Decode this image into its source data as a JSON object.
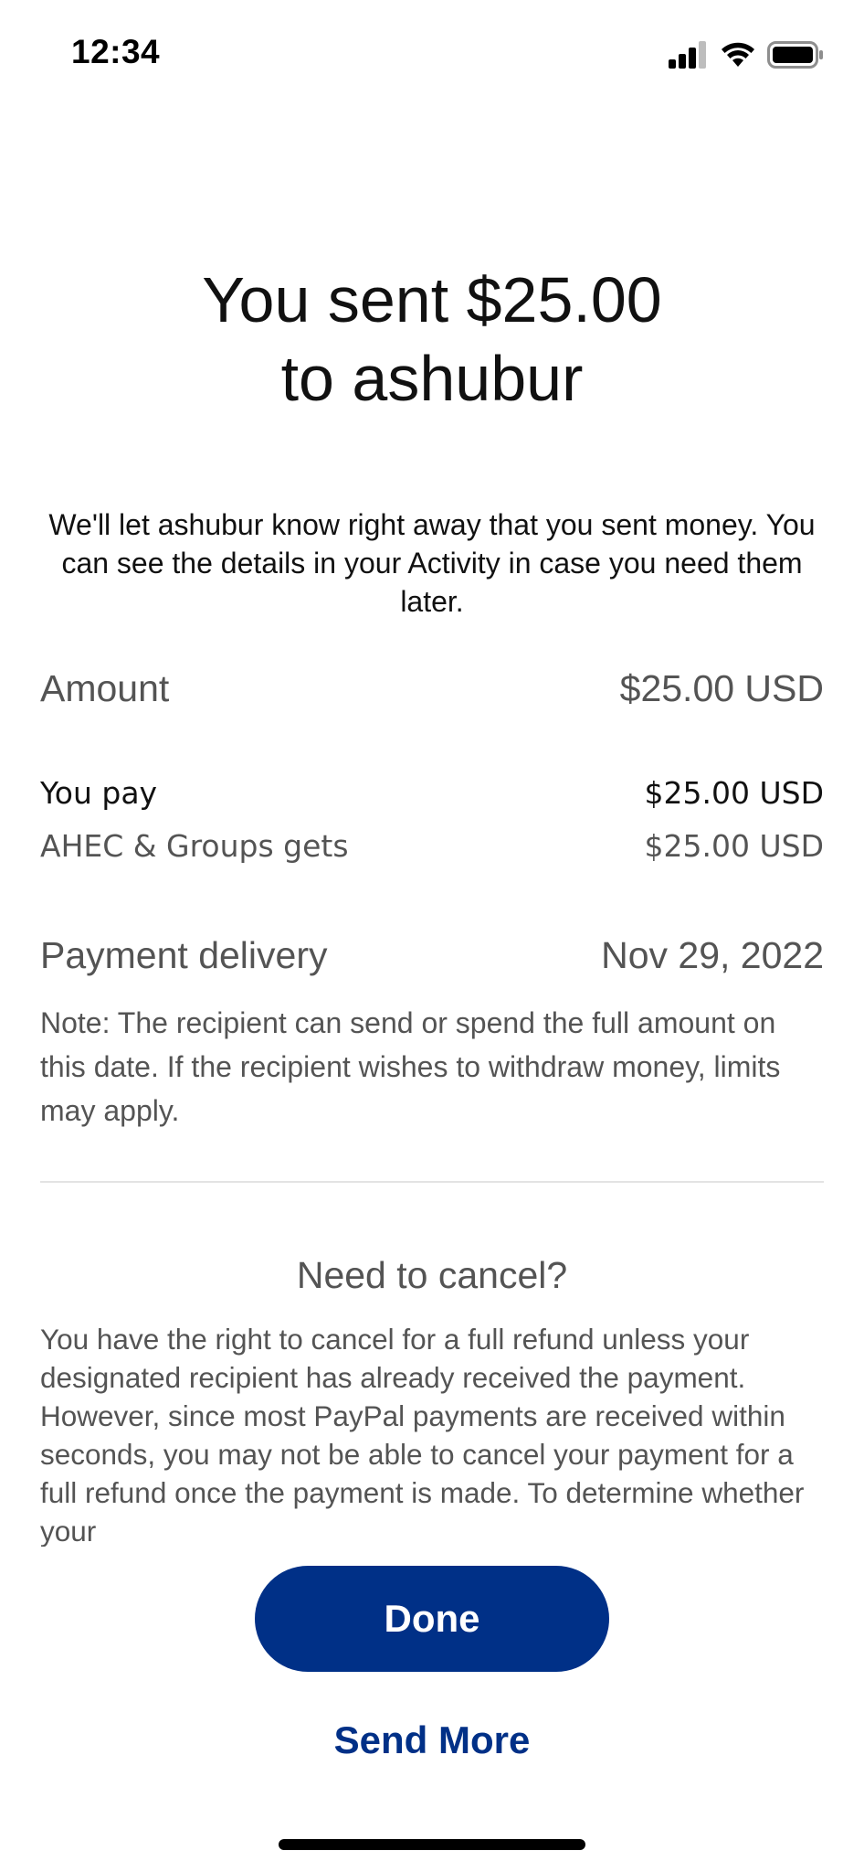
{
  "status_bar": {
    "time": "12:34",
    "icons": [
      "signal-icon",
      "wifi-icon",
      "battery-icon"
    ]
  },
  "header": {
    "title_line1": "You sent $25.00",
    "title_line2": "to ashubur",
    "subtitle": "We'll let ashubur know right away that you sent money. You can see the details in your Activity in case you need them later."
  },
  "details": {
    "amount_label": "Amount",
    "amount_value": "$25.00 USD",
    "you_pay_label": "You pay",
    "you_pay_value": "$25.00 USD",
    "recipient_gets_label": "AHEC & Groups gets",
    "recipient_gets_value": "$25.00 USD",
    "delivery_label": "Payment delivery",
    "delivery_value": "Nov 29, 2022",
    "note": "Note: The recipient can send or spend the full amount on this date. If the recipient wishes to withdraw money, limits may apply."
  },
  "cancel": {
    "heading": "Need to cancel?",
    "body": "You have the right to cancel for a full refund unless your designated recipient has already received the payment. However, since most PayPal payments are received within seconds, you may not be able to cancel your payment for a full refund once the payment is made. To determine whether your"
  },
  "actions": {
    "done_label": "Done",
    "send_more_label": "Send More"
  },
  "colors": {
    "brand_blue": "#003087",
    "secondary_text": "#545454"
  }
}
